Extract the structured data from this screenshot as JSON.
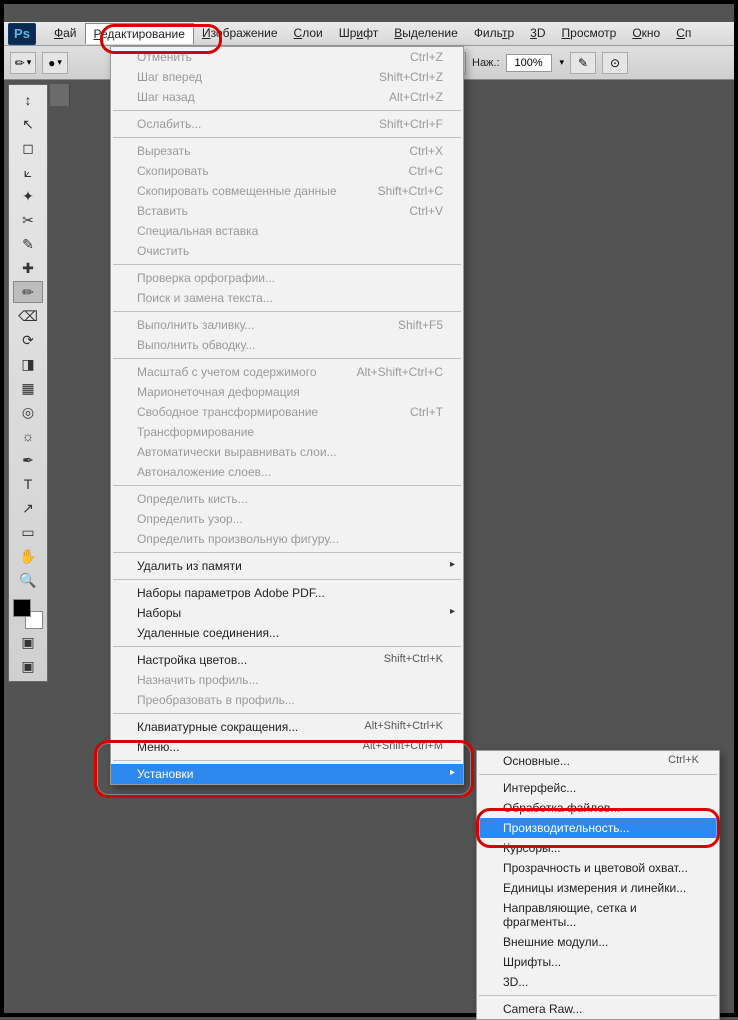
{
  "menubar": {
    "items": [
      {
        "html": "<u>Ф</u>ай"
      },
      {
        "html": "<u>Р</u>едактирование",
        "active": true
      },
      {
        "html": "<u>И</u>зображение"
      },
      {
        "html": "<u>С</u>лои"
      },
      {
        "html": "Шр<u>и</u>фт"
      },
      {
        "html": "<u>В</u>ыделение"
      },
      {
        "html": "Филь<u>т</u>р"
      },
      {
        "html": "<u>3</u>D"
      },
      {
        "html": "<u>П</u>росмотр"
      },
      {
        "html": "<u>О</u>кно"
      },
      {
        "html": "<u>С</u>п"
      }
    ]
  },
  "optbar": {
    "press_label": "Наж.:",
    "press_value": "100%"
  },
  "edit_menu": {
    "groups": [
      [
        {
          "label": "Отменить",
          "shortcut": "Ctrl+Z",
          "disabled": true
        },
        {
          "label": "Шаг вперед",
          "shortcut": "Shift+Ctrl+Z",
          "disabled": true
        },
        {
          "label": "Шаг назад",
          "shortcut": "Alt+Ctrl+Z",
          "disabled": true
        }
      ],
      [
        {
          "label": "Ослабить...",
          "shortcut": "Shift+Ctrl+F",
          "disabled": true
        }
      ],
      [
        {
          "label": "Вырезать",
          "shortcut": "Ctrl+X",
          "disabled": true
        },
        {
          "label": "Скопировать",
          "shortcut": "Ctrl+C",
          "disabled": true
        },
        {
          "label": "Скопировать совмещенные данные",
          "shortcut": "Shift+Ctrl+C",
          "disabled": true
        },
        {
          "label": "Вставить",
          "shortcut": "Ctrl+V",
          "disabled": true
        },
        {
          "label": "Специальная вставка",
          "submenu": true,
          "disabled": true
        },
        {
          "label": "Очистить",
          "disabled": true
        }
      ],
      [
        {
          "label": "Проверка орфографии...",
          "disabled": true
        },
        {
          "label": "Поиск и замена текста...",
          "disabled": true
        }
      ],
      [
        {
          "label": "Выполнить заливку...",
          "shortcut": "Shift+F5",
          "disabled": true
        },
        {
          "label": "Выполнить обводку...",
          "disabled": true
        }
      ],
      [
        {
          "label": "Масштаб с учетом содержимого",
          "shortcut": "Alt+Shift+Ctrl+C",
          "disabled": true
        },
        {
          "label": "Марионеточная деформация",
          "disabled": true
        },
        {
          "label": "Свободное трансформирование",
          "shortcut": "Ctrl+T",
          "disabled": true
        },
        {
          "label": "Трансформирование",
          "submenu": true,
          "disabled": true
        },
        {
          "label": "Автоматически выравнивать слои...",
          "disabled": true
        },
        {
          "label": "Автоналожение слоев...",
          "disabled": true
        }
      ],
      [
        {
          "label": "Определить кисть...",
          "disabled": true
        },
        {
          "label": "Определить узор...",
          "disabled": true
        },
        {
          "label": "Определить произвольную фигуру...",
          "disabled": true
        }
      ],
      [
        {
          "label": "Удалить из памяти",
          "submenu": true
        }
      ],
      [
        {
          "label": "Наборы параметров Adobe PDF..."
        },
        {
          "label": "Наборы",
          "submenu": true
        },
        {
          "label": "Удаленные соединения..."
        }
      ],
      [
        {
          "label": "Настройка цветов...",
          "shortcut": "Shift+Ctrl+K"
        },
        {
          "label": "Назначить профиль...",
          "disabled": true
        },
        {
          "label": "Преобразовать в профиль...",
          "disabled": true
        }
      ],
      [
        {
          "label": "Клавиатурные сокращения...",
          "shortcut": "Alt+Shift+Ctrl+K"
        },
        {
          "label": "Меню...",
          "shortcut": "Alt+Shift+Ctrl+M"
        }
      ],
      [
        {
          "label": "Установки",
          "submenu": true,
          "highlight": true
        }
      ]
    ]
  },
  "prefs_submenu": {
    "groups": [
      [
        {
          "label": "Основные...",
          "shortcut": "Ctrl+K"
        }
      ],
      [
        {
          "label": "Интерфейс..."
        },
        {
          "label": "Обработка файлов..."
        },
        {
          "label": "Производительность...",
          "highlight": true
        },
        {
          "label": "Курсоры..."
        },
        {
          "label": "Прозрачность и цветовой охват..."
        },
        {
          "label": "Единицы измерения и линейки..."
        },
        {
          "label": "Направляющие, сетка и фрагменты..."
        },
        {
          "label": "Внешние модули..."
        },
        {
          "label": "Шрифты..."
        },
        {
          "label": "3D..."
        }
      ],
      [
        {
          "label": "Camera Raw..."
        }
      ]
    ]
  },
  "tools": [
    {
      "g": "↕",
      "n": "expand"
    },
    {
      "g": "↖",
      "n": "move-tool"
    },
    {
      "g": "◻",
      "n": "marquee-tool"
    },
    {
      "g": "⟀",
      "n": "lasso-tool"
    },
    {
      "g": "✦",
      "n": "wand-tool"
    },
    {
      "g": "✂",
      "n": "crop-tool"
    },
    {
      "g": "✎",
      "n": "eyedropper-tool"
    },
    {
      "g": "✚",
      "n": "healing-tool"
    },
    {
      "g": "✏",
      "n": "brush-tool",
      "sel": true
    },
    {
      "g": "⌫",
      "n": "stamp-tool"
    },
    {
      "g": "⟳",
      "n": "history-brush"
    },
    {
      "g": "◨",
      "n": "eraser-tool"
    },
    {
      "g": "▦",
      "n": "gradient-tool"
    },
    {
      "g": "◎",
      "n": "blur-tool"
    },
    {
      "g": "☼",
      "n": "dodge-tool"
    },
    {
      "g": "✒",
      "n": "pen-tool"
    },
    {
      "g": "T",
      "n": "type-tool"
    },
    {
      "g": "↗",
      "n": "path-select"
    },
    {
      "g": "▭",
      "n": "shape-tool"
    },
    {
      "g": "✋",
      "n": "hand-tool"
    },
    {
      "g": "🔍",
      "n": "zoom-tool"
    }
  ]
}
